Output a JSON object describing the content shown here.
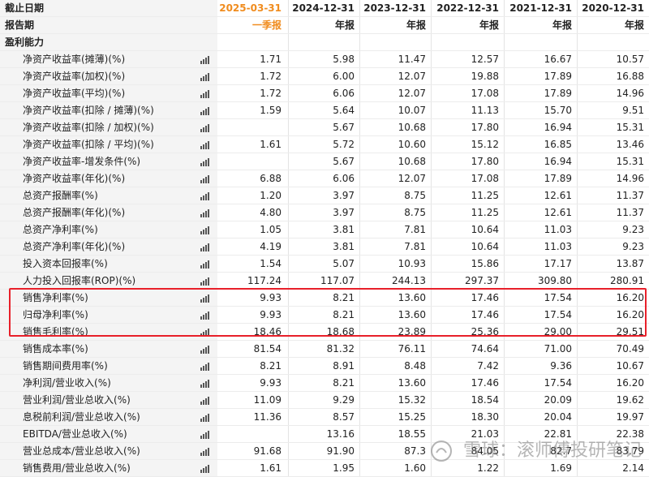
{
  "header": {
    "date_label": "截止日期",
    "period_label": "报告期",
    "dates": [
      "2025-03-31",
      "2024-12-31",
      "2023-12-31",
      "2022-12-31",
      "2021-12-31",
      "2020-12-31"
    ],
    "types": [
      "一季报",
      "年报",
      "年报",
      "年报",
      "年报",
      "年报"
    ]
  },
  "section": {
    "title": "盈利能力"
  },
  "rows": [
    {
      "label": "净资产收益率(摊薄)(%)",
      "values": [
        "1.71",
        "5.98",
        "11.47",
        "12.57",
        "16.67",
        "10.57"
      ]
    },
    {
      "label": "净资产收益率(加权)(%)",
      "values": [
        "1.72",
        "6.00",
        "12.07",
        "19.88",
        "17.89",
        "16.88"
      ]
    },
    {
      "label": "净资产收益率(平均)(%)",
      "values": [
        "1.72",
        "6.06",
        "12.07",
        "17.08",
        "17.89",
        "14.96"
      ]
    },
    {
      "label": "净资产收益率(扣除 / 摊薄)(%)",
      "values": [
        "1.59",
        "5.64",
        "10.07",
        "11.13",
        "15.70",
        "9.51"
      ]
    },
    {
      "label": "净资产收益率(扣除 / 加权)(%)",
      "values": [
        "",
        "5.67",
        "10.68",
        "17.80",
        "16.94",
        "15.31"
      ]
    },
    {
      "label": "净资产收益率(扣除 / 平均)(%)",
      "values": [
        "1.61",
        "5.72",
        "10.60",
        "15.12",
        "16.85",
        "13.46"
      ]
    },
    {
      "label": "净资产收益率-增发条件(%)",
      "values": [
        "",
        "5.67",
        "10.68",
        "17.80",
        "16.94",
        "15.31"
      ]
    },
    {
      "label": "净资产收益率(年化)(%)",
      "values": [
        "6.88",
        "6.06",
        "12.07",
        "17.08",
        "17.89",
        "14.96"
      ]
    },
    {
      "label": "总资产报酬率(%)",
      "values": [
        "1.20",
        "3.97",
        "8.75",
        "11.25",
        "12.61",
        "11.37"
      ]
    },
    {
      "label": "总资产报酬率(年化)(%)",
      "values": [
        "4.80",
        "3.97",
        "8.75",
        "11.25",
        "12.61",
        "11.37"
      ]
    },
    {
      "label": "总资产净利率(%)",
      "values": [
        "1.05",
        "3.81",
        "7.81",
        "10.64",
        "11.03",
        "9.23"
      ]
    },
    {
      "label": "总资产净利率(年化)(%)",
      "values": [
        "4.19",
        "3.81",
        "7.81",
        "10.64",
        "11.03",
        "9.23"
      ]
    },
    {
      "label": "投入资本回报率(%)",
      "values": [
        "1.54",
        "5.07",
        "10.93",
        "15.86",
        "17.17",
        "13.87"
      ]
    },
    {
      "label": "人力投入回报率(ROP)(%)",
      "values": [
        "117.24",
        "117.07",
        "244.13",
        "297.37",
        "309.80",
        "280.91"
      ]
    },
    {
      "label": "销售净利率(%)",
      "values": [
        "9.93",
        "8.21",
        "13.60",
        "17.46",
        "17.54",
        "16.20"
      ]
    },
    {
      "label": "归母净利率(%)",
      "values": [
        "9.93",
        "8.21",
        "13.60",
        "17.46",
        "17.54",
        "16.20"
      ]
    },
    {
      "label": "销售毛利率(%)",
      "values": [
        "18.46",
        "18.68",
        "23.89",
        "25.36",
        "29.00",
        "29.51"
      ]
    },
    {
      "label": "销售成本率(%)",
      "values": [
        "81.54",
        "81.32",
        "76.11",
        "74.64",
        "71.00",
        "70.49"
      ]
    },
    {
      "label": "销售期间费用率(%)",
      "values": [
        "8.21",
        "8.91",
        "8.48",
        "7.42",
        "9.36",
        "10.67"
      ]
    },
    {
      "label": "净利润/营业收入(%)",
      "values": [
        "9.93",
        "8.21",
        "13.60",
        "17.46",
        "17.54",
        "16.20"
      ]
    },
    {
      "label": "营业利润/营业总收入(%)",
      "values": [
        "11.09",
        "9.29",
        "15.32",
        "18.54",
        "20.09",
        "19.62"
      ]
    },
    {
      "label": "息税前利润/营业总收入(%)",
      "values": [
        "11.36",
        "8.57",
        "15.25",
        "18.30",
        "20.04",
        "19.97"
      ]
    },
    {
      "label": "EBITDA/营业总收入(%)",
      "values": [
        "",
        "13.16",
        "18.55",
        "21.03",
        "22.81",
        "22.38"
      ]
    },
    {
      "label": "营业总成本/营业总收入(%)",
      "values": [
        "91.68",
        "91.90",
        "87.3",
        "84.05",
        "82.7",
        "83.79"
      ]
    },
    {
      "label": "销售费用/营业总收入(%)",
      "values": [
        "1.61",
        "1.95",
        "1.60",
        "1.22",
        "1.69",
        "2.14"
      ]
    }
  ],
  "watermark": {
    "text": "雪球：滚师傅投研笔记"
  },
  "colors": {
    "current_period": "#f08c1e",
    "highlight": "#e8202a",
    "label_bg": "#f4f4f4"
  }
}
